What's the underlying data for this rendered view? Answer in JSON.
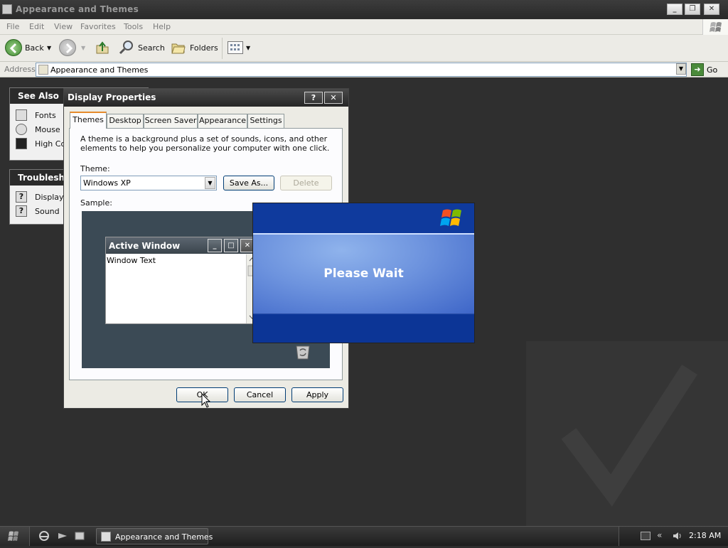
{
  "explorer": {
    "title": "Appearance and Themes",
    "menu": [
      "File",
      "Edit",
      "View",
      "Favorites",
      "Tools",
      "Help"
    ],
    "toolbar": {
      "back_label": "Back",
      "search_label": "Search",
      "folders_label": "Folders"
    },
    "address": {
      "label": "Address",
      "value": "Appearance and Themes",
      "go_label": "Go"
    },
    "see_also": {
      "header": "See Also",
      "items": [
        "Fonts",
        "Mouse P",
        "High Co"
      ]
    },
    "troubleshooters": {
      "header": "Troublesho",
      "items": [
        "Display",
        "Sound"
      ]
    }
  },
  "dialog": {
    "title": "Display Properties",
    "help_btn": "?",
    "close_btn": "✕",
    "tabs": [
      "Themes",
      "Desktop",
      "Screen Saver",
      "Appearance",
      "Settings"
    ],
    "active_tab": "Themes",
    "description": "A theme is a background plus a set of sounds, icons, and other elements to help you personalize your computer with one click.",
    "theme_label": "Theme:",
    "theme_value": "Windows XP",
    "save_as": "Save As...",
    "delete": "Delete",
    "sample_label": "Sample:",
    "sample": {
      "active_window_title": "Active Window",
      "window_text": "Window Text"
    },
    "ok": "OK",
    "cancel": "Cancel",
    "apply": "Apply"
  },
  "splash": {
    "message": "Please Wait"
  },
  "taskbar": {
    "task_label": "Appearance and Themes",
    "clock": "2:18 AM",
    "tray_chevron": "«"
  },
  "colors": {
    "splash_blue": "#0e3a9c",
    "tab_active_accent": "#e68b2c",
    "dark_theme": "#2e2e2e"
  }
}
